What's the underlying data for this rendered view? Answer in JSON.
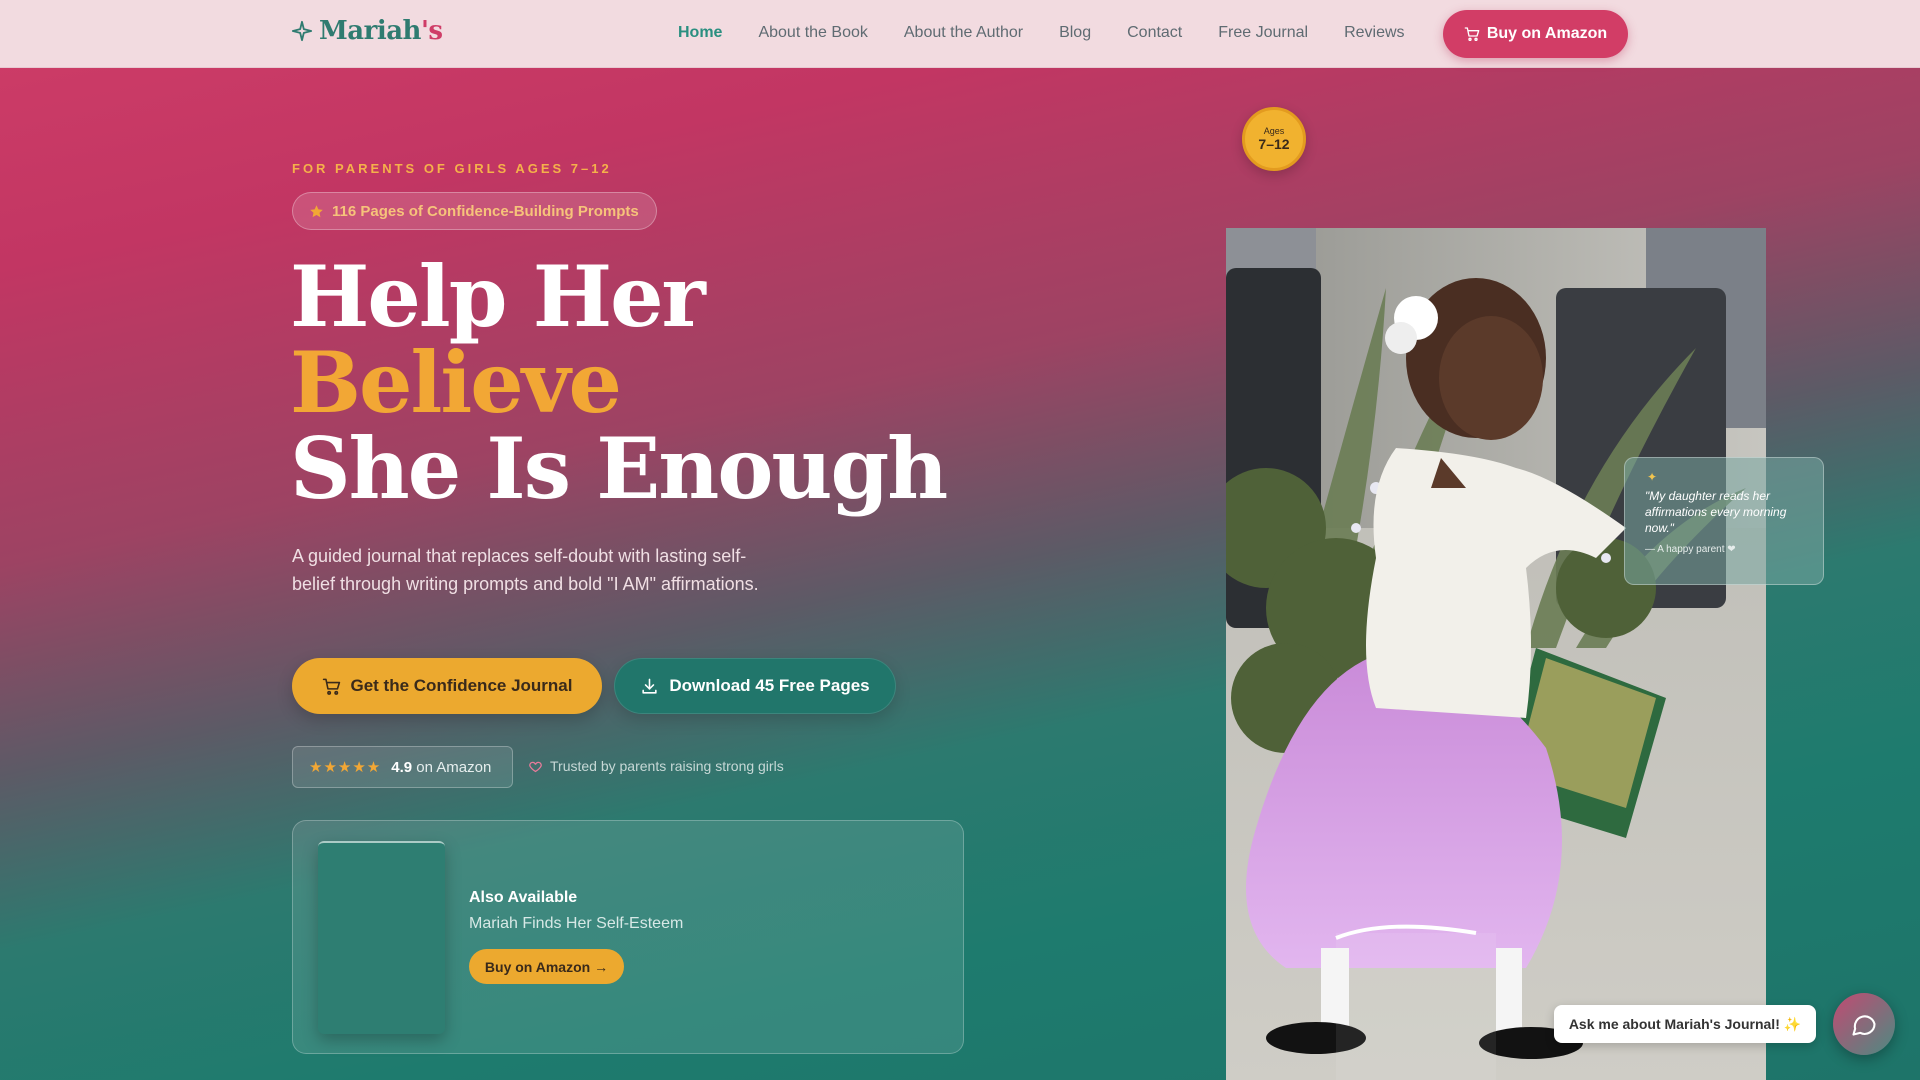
{
  "brand": {
    "name_part1": "Mariah",
    "name_part2": "'s",
    "icon": "sparkle-icon"
  },
  "nav": {
    "links": [
      "Home",
      "About the Book",
      "About the Author",
      "Blog",
      "Contact",
      "Free Journal",
      "Reviews"
    ],
    "active": "Home",
    "buy_label": "Buy on Amazon"
  },
  "hero": {
    "eyebrow": "FOR PARENTS OF GIRLS AGES 7–12",
    "pill": "116 Pages of Confidence-Building Prompts",
    "headline": {
      "line1": "Help Her",
      "line2": "Believe",
      "line3": "She Is Enough"
    },
    "subtitle": "A guided journal that replaces self-doubt with lasting self-belief through writing prompts and bold \"I AM\" affirmations.",
    "cta_primary": "Get the Confidence Journal",
    "cta_secondary": "Download 45 Free Pages",
    "rating": {
      "stars": "★★★★★",
      "score": "4.9",
      "suffix": "on Amazon"
    },
    "trusted": "Trusted by parents raising strong girls"
  },
  "also_available": {
    "title": "Also Available",
    "book": "Mariah Finds Her Self-Esteem",
    "button": "Buy on Amazon →"
  },
  "age_badge": {
    "label": "Ages",
    "range": "7–12"
  },
  "testimonial": {
    "quote": "\"My daughter reads her affirmations every morning now.\"",
    "author": "— A happy parent ❤"
  },
  "chat": {
    "prompt": "Ask me about Mariah's Journal! ✨"
  },
  "colors": {
    "accent": "#d23d66",
    "gold": "#eca92f",
    "teal": "#21766b"
  }
}
